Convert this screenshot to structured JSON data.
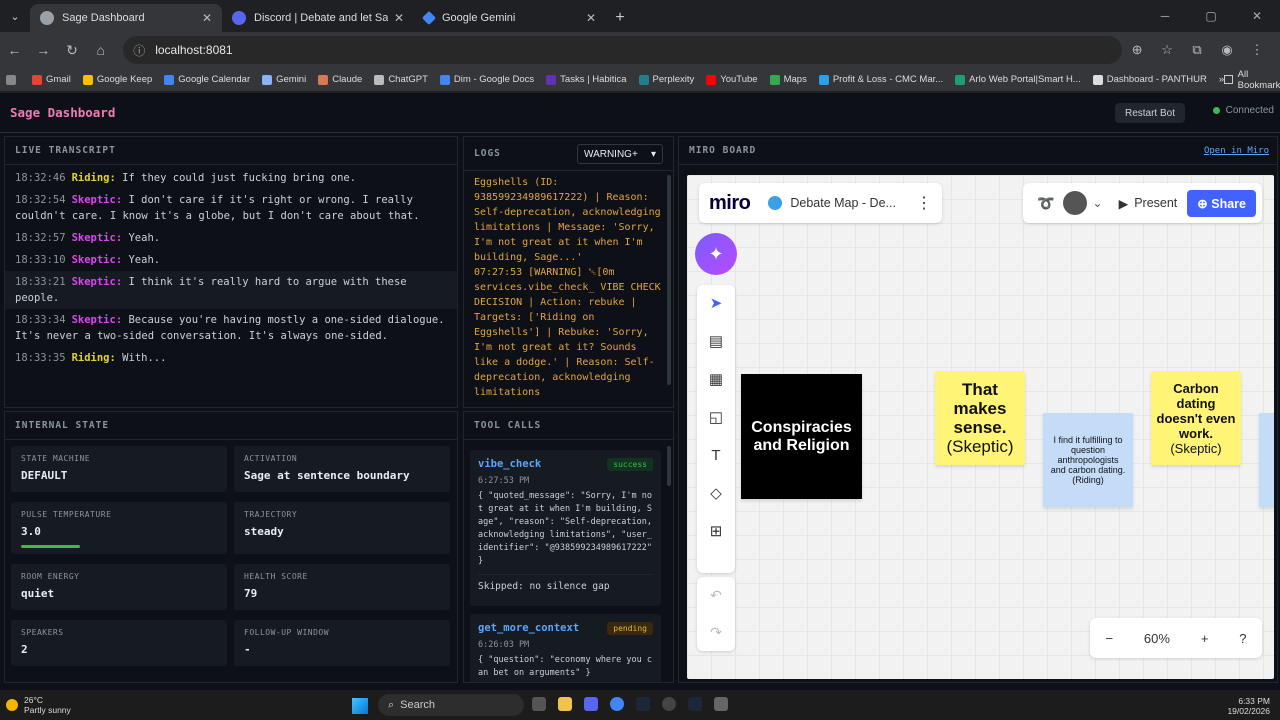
{
  "browser": {
    "tabs": [
      {
        "title": "Sage Dashboard",
        "color": "#9aa0a6"
      },
      {
        "title": "Discord | Debate and let Sage",
        "color": "#5865f2"
      },
      {
        "title": "Google Gemini",
        "color": "#4285f4"
      }
    ],
    "url": "localhost:8081",
    "bookmarks": [
      "Gmail",
      "Google Keep",
      "Google Calendar",
      "Gemini",
      "Claude",
      "ChatGPT",
      "Dim - Google Docs",
      "Tasks | Habitica",
      "Perplexity",
      "YouTube",
      "Maps",
      "Profit & Loss - CMC Mar...",
      "Arlo Web Portal|Smart H...",
      "Dashboard - PANTHUR"
    ],
    "all_bookmarks": "All Bookmarks"
  },
  "app": {
    "title": "Sage Dashboard",
    "restart_label": "Restart Bot",
    "status": "Connected",
    "status_color": "#3fb950"
  },
  "transcript": {
    "header": "LIVE TRANSCRIPT",
    "lines": [
      {
        "time": "18:32:46",
        "speaker": "Riding:",
        "text": "If they could just fucking bring one."
      },
      {
        "time": "18:32:54",
        "speaker": "Skeptic:",
        "text": "I don't care if it's right or wrong. I really couldn't care. I know it's a globe, but I don't care about that."
      },
      {
        "time": "18:32:57",
        "speaker": "Skeptic:",
        "text": "Yeah."
      },
      {
        "time": "18:33:10",
        "speaker": "Skeptic:",
        "text": "Yeah."
      },
      {
        "time": "18:33:21",
        "speaker": "Skeptic:",
        "text": "I think it's really hard to argue with these people."
      },
      {
        "time": "18:33:34",
        "speaker": "Skeptic:",
        "text": "Because you're having mostly a one-sided dialogue. It's never a two-sided conversation. It's always one-sided."
      },
      {
        "time": "18:33:35",
        "speaker": "Riding:",
        "text": "With..."
      }
    ]
  },
  "logs": {
    "header": "LOGS",
    "level": "WARNING+",
    "lines": [
      "Eggshells (ID:",
      "938599234989617222) | Reason:",
      "Self-deprecation, acknowledging",
      "limitations | Message: 'Sorry,",
      "I'm not great at it when I'm",
      "building, Sage...'",
      "07:27:53  [WARNING]  ␛[0m",
      "services.vibe_check_ VIBE CHECK",
      "DECISION | Action: rebuke |",
      "Targets: ['Riding on",
      "Eggshells'] | Rebuke: 'Sorry,",
      "I'm not great at it? Sounds",
      "like a dodge.' | Reason: Self-",
      "deprecation, acknowledging",
      "limitations"
    ]
  },
  "state": {
    "header": "INTERNAL STATE",
    "cards": [
      {
        "label": "STATE MACHINE",
        "value": "DEFAULT"
      },
      {
        "label": "ACTIVATION",
        "value": "Sage at sentence boundary"
      },
      {
        "label": "PULSE TEMPERATURE",
        "value": "3.0"
      },
      {
        "label": "TRAJECTORY",
        "value": "steady"
      },
      {
        "label": "ROOM ENERGY",
        "value": "quiet"
      },
      {
        "label": "HEALTH SCORE",
        "value": "79"
      },
      {
        "label": "SPEAKERS",
        "value": "2"
      },
      {
        "label": "FOLLOW-UP WINDOW",
        "value": "-"
      }
    ],
    "pulse_level": 0.3
  },
  "tools": {
    "header": "TOOL CALLS",
    "calls": [
      {
        "name": "vibe_check",
        "status": "success",
        "time": "6:27:53 PM",
        "body": "{ \"quoted_message\": \"Sorry, I'm not great at it when I'm building, Sage\", \"reason\": \"Self-deprecation, acknowledging limitations\", \"user_identifier\": \"@938599234989617222\" }",
        "note": "Skipped: no silence gap"
      },
      {
        "name": "get_more_context",
        "status": "pending",
        "time": "6:26:03 PM",
        "body": "{ \"question\": \"economy where you can bet on arguments\" }"
      }
    ]
  },
  "miro": {
    "header": "MIRO BOARD",
    "open_label": "Open in Miro",
    "logo": "miro",
    "board_name": "Debate Map - De...",
    "present_label": "Present",
    "share_label": "Share",
    "zoom": "60%",
    "stickies": [
      {
        "title": "Conspiracies and Religion",
        "sub": ""
      },
      {
        "title": "That makes sense.",
        "sub": "(Skeptic)"
      },
      {
        "title": "I find it fulfilling to question anthropologists and carbon dating.",
        "sub": "(Riding)"
      },
      {
        "title": "Carbon dating doesn't even work.",
        "sub": "(Skeptic)"
      }
    ]
  },
  "taskbar": {
    "temp": "26°C",
    "weather": "Partly sunny",
    "search": "Search",
    "time": "6:33 PM",
    "date": "19/02/2026"
  }
}
